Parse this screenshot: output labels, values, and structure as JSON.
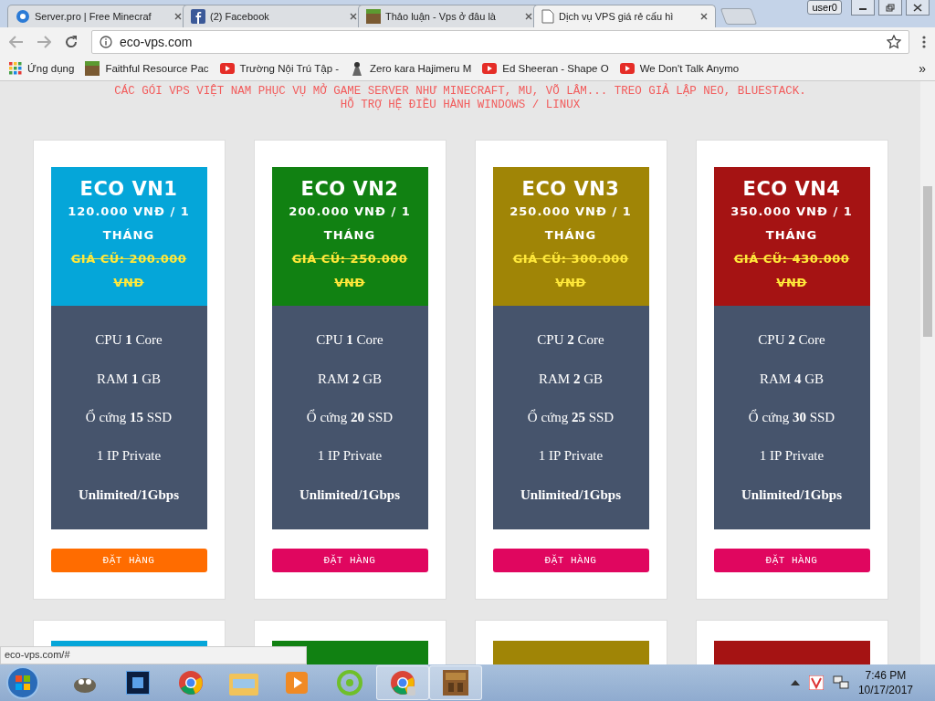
{
  "browser": {
    "tabs": [
      {
        "title": "Server.pro | Free Minecraf",
        "selected": false
      },
      {
        "title": "(2) Facebook",
        "selected": false
      },
      {
        "title": "Thảo luận - Vps ở đâu là",
        "selected": false
      },
      {
        "title": "Dịch vụ VPS giá rẻ cấu hì",
        "selected": true
      }
    ],
    "user_badge": "user0",
    "url": "eco-vps.com",
    "bookmarks": [
      {
        "label": "Ứng dụng"
      },
      {
        "label": "Faithful Resource Pac"
      },
      {
        "label": "Trường Nội Trú Tập -"
      },
      {
        "label": "Zero kara Hajimeru M"
      },
      {
        "label": "Ed Sheeran - Shape O"
      },
      {
        "label": "We Don't Talk Anymo"
      }
    ],
    "more": "»"
  },
  "page": {
    "intro": [
      "CÁC GÓI VPS VIỆT NAM PHỤC VỤ MỞ GAME SERVER NHƯ MINECRAFT, MU, VÕ LÂM... TREO GIẢ LẬP NEO, BLUESTACK.",
      "HỖ TRỢ HỆ ĐIỀU HÀNH WINDOWS / LINUX"
    ],
    "plans": [
      {
        "title": "ECO VN1",
        "price": "120.000 VNĐ / 1 THÁNG",
        "old_price": "GIÁ CŨ: 200.000 VNĐ",
        "color": "#05a6d9",
        "specs": [
          {
            "kind": "mixed",
            "text": "CPU **1** Core"
          },
          {
            "kind": "mixed",
            "text": "RAM **1** GB"
          },
          {
            "kind": "mixed",
            "text": "Ổ cứng **15** SSD"
          },
          {
            "kind": "plain",
            "text": "1 IP Private"
          },
          {
            "kind": "bold",
            "text": "Unlimited/1Gbps"
          }
        ],
        "button": {
          "label": "ĐẶT HÀNG",
          "color": "#ff6c00"
        }
      },
      {
        "title": "ECO VN2",
        "price": "200.000 VNĐ / 1 THÁNG",
        "old_price": "GIÁ CŨ: 250.000 VNĐ",
        "color": "#118112",
        "specs": [
          {
            "kind": "mixed",
            "text": "CPU **1** Core"
          },
          {
            "kind": "mixed",
            "text": "RAM **2** GB"
          },
          {
            "kind": "mixed",
            "text": "Ổ cứng **20** SSD"
          },
          {
            "kind": "plain",
            "text": "1 IP Private"
          },
          {
            "kind": "bold",
            "text": "Unlimited/1Gbps"
          }
        ],
        "button": {
          "label": "ĐẶT HÀNG",
          "color": "#e0065f"
        }
      },
      {
        "title": "ECO VN3",
        "price": "250.000 VNĐ / 1 THÁNG",
        "old_price": "GIÁ CŨ: 300.000 VNĐ",
        "color": "#a08506",
        "specs": [
          {
            "kind": "mixed",
            "text": "CPU **2** Core"
          },
          {
            "kind": "mixed",
            "text": "RAM **2** GB"
          },
          {
            "kind": "mixed",
            "text": "Ổ cứng **25** SSD"
          },
          {
            "kind": "plain",
            "text": "1 IP Private"
          },
          {
            "kind": "bold",
            "text": "Unlimited/1Gbps"
          }
        ],
        "button": {
          "label": "ĐẶT HÀNG",
          "color": "#e0065f"
        }
      },
      {
        "title": "ECO VN4",
        "price": "350.000 VNĐ / 1 THÁNG",
        "old_price": "GIÁ CŨ: 430.000 VNĐ",
        "color": "#a51313",
        "specs": [
          {
            "kind": "mixed",
            "text": "CPU **2** Core"
          },
          {
            "kind": "mixed",
            "text": "RAM **4** GB"
          },
          {
            "kind": "mixed",
            "text": "Ổ cứng **30** SSD"
          },
          {
            "kind": "plain",
            "text": "1 IP Private"
          },
          {
            "kind": "bold",
            "text": "Unlimited/1Gbps"
          }
        ],
        "button": {
          "label": "ĐẶT HÀNG",
          "color": "#e0065f"
        }
      }
    ],
    "next_plans": [
      {
        "color": "#05a6d9"
      },
      {
        "color": "#118112"
      },
      {
        "color": "#a08506"
      },
      {
        "color": "#a51313"
      }
    ]
  },
  "status_link": "eco-vps.com/#",
  "taskbar": {
    "apps": [
      {
        "active": false
      },
      {
        "active": false
      },
      {
        "active": false
      },
      {
        "active": false
      },
      {
        "active": false
      },
      {
        "active": false
      },
      {
        "active": true
      },
      {
        "active": true
      }
    ],
    "time": "7:46 PM",
    "date": "10/17/2017"
  }
}
